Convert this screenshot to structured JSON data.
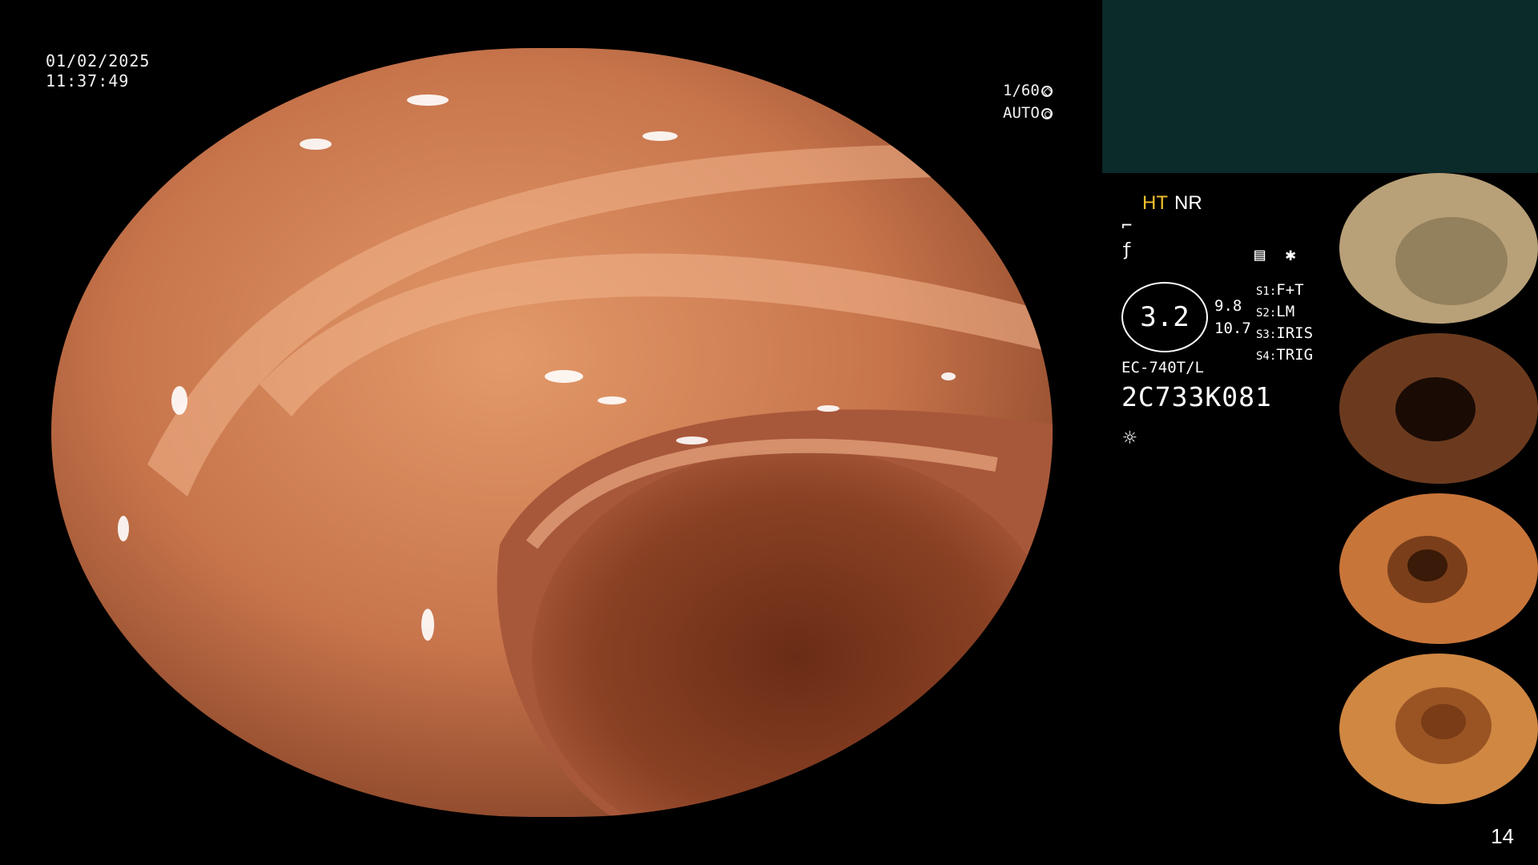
{
  "overlay": {
    "date": "01/02/2025",
    "time": "11:37:49",
    "shutter": "1/60",
    "iris_mode": "AUTO"
  },
  "panel": {
    "mode_ht": "HT",
    "mode_nr": "NR",
    "icon_1": "⌐",
    "icon_2": "ƒ",
    "gauge_value": "3.2",
    "side_value_1": "9.8",
    "side_value_2": "10.7",
    "settings": [
      {
        "key": "S1:",
        "value": "F+T"
      },
      {
        "key": "S2:",
        "value": "LM"
      },
      {
        "key": "S3:",
        "value": "IRIS"
      },
      {
        "key": "S4:",
        "value": "TRIG"
      }
    ],
    "scope_model": "EC-740T/L",
    "scope_serial": "2C733K081",
    "light_icon": "light-icon"
  },
  "thumbnails": [
    {
      "name": "thumb-1",
      "tone": "#b8a078"
    },
    {
      "name": "thumb-2",
      "tone": "#6b3a1e"
    },
    {
      "name": "thumb-3",
      "tone": "#c8753a"
    },
    {
      "name": "thumb-4",
      "tone": "#d08742"
    }
  ],
  "page_number": "14",
  "colors": {
    "mucosa": "#c7744b",
    "teal_panel": "#0b2a2a",
    "ht_color": "#f3c22b"
  }
}
